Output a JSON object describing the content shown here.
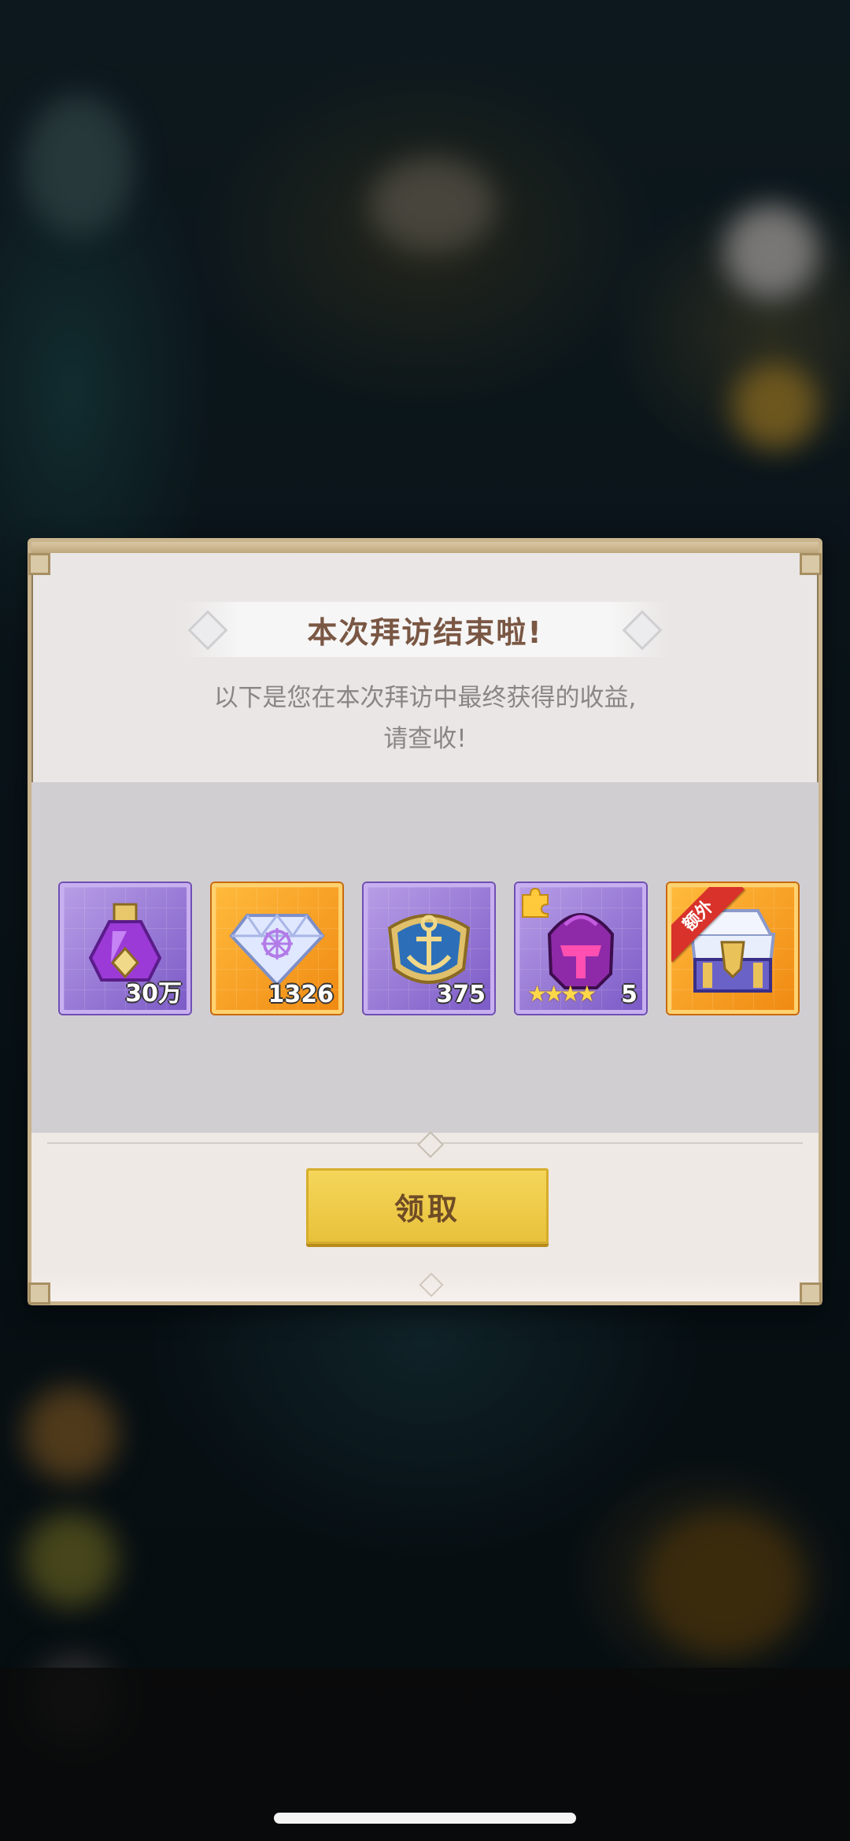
{
  "dialog": {
    "title": "本次拜访结束啦!",
    "description_line1": "以下是您在本次拜访中最终获得的收益,",
    "description_line2": "请查收!",
    "claim_label": "领取"
  },
  "rewards": [
    {
      "icon": "purple-potion-icon",
      "count": "30万",
      "frame": "purple"
    },
    {
      "icon": "diamond-icon",
      "count": "1326",
      "frame": "orange"
    },
    {
      "icon": "anchor-emblem-icon",
      "count": "375",
      "frame": "purple"
    },
    {
      "icon": "helmet-fragment-icon",
      "count": "5",
      "stars": "★★★★",
      "frame": "purple"
    },
    {
      "icon": "treasure-chest-icon",
      "badge": "额外",
      "frame": "orange"
    }
  ],
  "colors": {
    "title": "#7a5744",
    "button": "#e8c13b",
    "extra_badge": "#d8322a"
  }
}
